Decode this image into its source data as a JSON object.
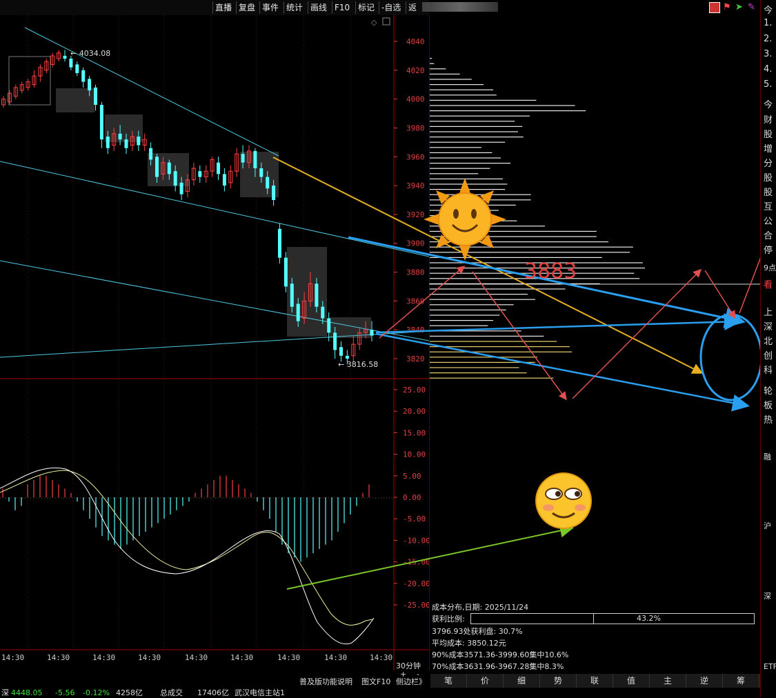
{
  "toolbar": {
    "buttons": [
      "直播",
      "复盘",
      "事件",
      "统计",
      "画线",
      "F10",
      "标记",
      "-自选",
      "返"
    ]
  },
  "chart": {
    "price_ticks": [
      "4040",
      "4020",
      "4000",
      "3980",
      "3960",
      "3940",
      "3920",
      "3900",
      "3880",
      "3860",
      "3840",
      "3820"
    ],
    "macd_ticks": [
      "25.00",
      "20.00",
      "15.00",
      "10.00",
      "5.00",
      "0.00",
      "-5.00",
      "-10.00",
      "-15.00",
      "-20.00",
      "-25.00"
    ],
    "high_label": "4034.08",
    "low_label": "3816.58",
    "annotation_3883": "3883",
    "time_labels": [
      "14:30",
      "14:30",
      "14:30",
      "14:30",
      "14:30",
      "14:30",
      "14:30",
      "14:30",
      "14:30"
    ],
    "period": "30分钟",
    "plus": "+",
    "minus": "-"
  },
  "cost_info": {
    "title": "成本分布,日期: 2025/11/24",
    "ratio_label": "获利比例:",
    "ratio_value": "43.2%",
    "ratio_fraction": 0.432,
    "line1": "3796.93处获利盘: 30.7%",
    "line2": "平均成本: 3850.12元",
    "line3": "90%成本3571.36-3999.60集中10.6%",
    "line4": "70%成本3631.96-3967.28集中8.3%"
  },
  "bottom_tabs": [
    "笔",
    "价",
    "细",
    "势",
    "联",
    "值",
    "主",
    "逆",
    "筹"
  ],
  "bottom_left": {
    "help": "普及版功能说明",
    "f10": "图文F10",
    "sidebar": "侧边栏》"
  },
  "statusbar": {
    "index": "深",
    "value": "4448.05",
    "change": "-5.56",
    "pct": "-0.12%",
    "volume": "4258亿",
    "total_label": "总成交",
    "total": "17406亿",
    "station": "武汉电信主站1"
  },
  "sidebar": {
    "items": [
      "今",
      "1.",
      "2.",
      "3.",
      "4.",
      "5.",
      "今",
      "财",
      "股",
      "增",
      "分",
      "股",
      "股",
      "互",
      "公",
      "合",
      "停",
      "9点",
      "看",
      "上",
      "深",
      "北",
      "创",
      "科",
      "轮",
      "板",
      "热",
      "融",
      "沪",
      "深",
      "ETF"
    ]
  },
  "colors": {
    "up": "#ff4040",
    "down": "#54ffff",
    "axis": "#e04040",
    "blue_line": "#1e9be8",
    "yellow_line": "#e8b020"
  },
  "chart_data": {
    "type": "candlestick",
    "ylim": [
      3810,
      4045
    ],
    "high": 4034.08,
    "low": 3816.58,
    "macd_ylim": [
      -30,
      28
    ]
  }
}
